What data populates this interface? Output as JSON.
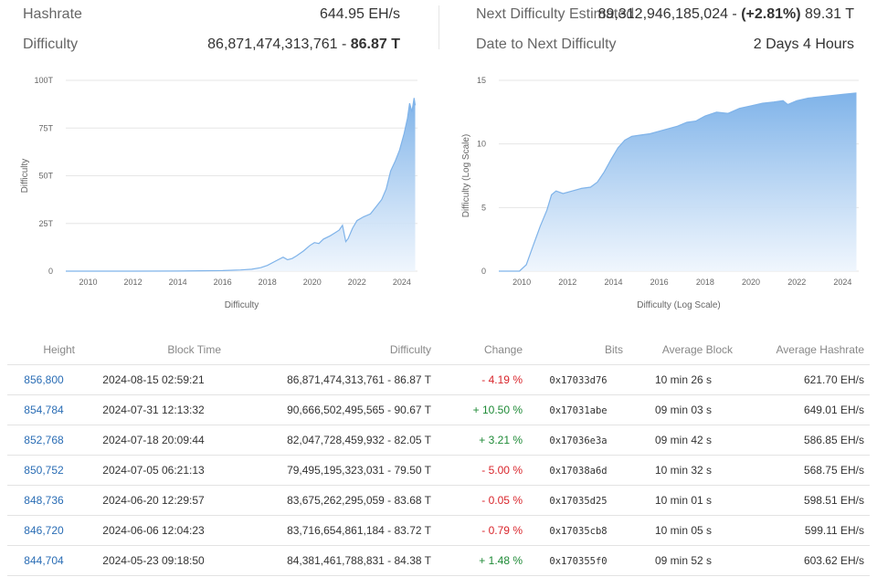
{
  "stats": {
    "hashrate_label": "Hashrate",
    "hashrate_value": "644.95 EH/s",
    "difficulty_label": "Difficulty",
    "difficulty_value_prefix": "86,871,474,313,761 - ",
    "difficulty_value_bold": "86.87 T",
    "next_label": "Next Difficulty Estimated",
    "next_value_prefix": "89,312,946,185,024 - ",
    "next_value_bold": "(+2.81%)",
    "next_value_suffix": " 89.31 T",
    "date_next_label": "Date to Next Difficulty",
    "date_next_value": "2 Days 4 Hours"
  },
  "colors": {
    "area_top": "#7fb3e9",
    "area_bottom": "#eef5fd",
    "line": "#7fb3e9",
    "grid": "#e6e6e6",
    "link": "#2a6db5",
    "negative": "#d9262c",
    "positive": "#1e8a36"
  },
  "chart_data": [
    {
      "type": "area",
      "xlabel": "Difficulty",
      "ylabel": "Difficulty",
      "xlim": [
        2009,
        2024.7
      ],
      "ylim": [
        0,
        100
      ],
      "yticks": [
        {
          "v": 0,
          "label": "0"
        },
        {
          "v": 25,
          "label": "25T"
        },
        {
          "v": 50,
          "label": "50T"
        },
        {
          "v": 75,
          "label": "75T"
        },
        {
          "v": 100,
          "label": "100T"
        }
      ],
      "xticks": [
        {
          "v": 2010,
          "label": "2010"
        },
        {
          "v": 2012,
          "label": "2012"
        },
        {
          "v": 2014,
          "label": "2014"
        },
        {
          "v": 2016,
          "label": "2016"
        },
        {
          "v": 2018,
          "label": "2018"
        },
        {
          "v": 2020,
          "label": "2020"
        },
        {
          "v": 2022,
          "label": "2022"
        },
        {
          "v": 2024,
          "label": "2024"
        }
      ],
      "grid": true,
      "x": [
        2009.0,
        2012.0,
        2014.0,
        2016.0,
        2016.8,
        2017.3,
        2017.7,
        2018.0,
        2018.4,
        2018.7,
        2018.9,
        2019.1,
        2019.3,
        2019.6,
        2019.9,
        2020.1,
        2020.3,
        2020.5,
        2020.8,
        2021.0,
        2021.2,
        2021.35,
        2021.5,
        2021.6,
        2021.8,
        2022.0,
        2022.3,
        2022.6,
        2022.9,
        2023.1,
        2023.3,
        2023.5,
        2023.7,
        2023.9,
        2024.1,
        2024.25,
        2024.35,
        2024.45,
        2024.55,
        2024.6
      ],
      "values": [
        0,
        0,
        0.04,
        0.3,
        0.6,
        1.0,
        1.8,
        3.0,
        5.5,
        7.3,
        6.0,
        6.6,
        8.0,
        10.5,
        13.5,
        15.0,
        14.5,
        16.8,
        18.5,
        20.0,
        21.5,
        24.0,
        15.5,
        17.0,
        22.5,
        26.5,
        28.5,
        30.0,
        34.5,
        37.5,
        43.0,
        52.5,
        57.5,
        63.5,
        72.0,
        80.0,
        88.0,
        83.5,
        90.7,
        86.9
      ]
    },
    {
      "type": "area",
      "xlabel": "Difficulty (Log Scale)",
      "ylabel": "Difficulty (Log Scale)",
      "xlim": [
        2009,
        2024.7
      ],
      "ylim": [
        0,
        15
      ],
      "yticks": [
        {
          "v": 0,
          "label": "0"
        },
        {
          "v": 5,
          "label": "5"
        },
        {
          "v": 10,
          "label": "10"
        },
        {
          "v": 15,
          "label": "15"
        }
      ],
      "xticks": [
        {
          "v": 2010,
          "label": "2010"
        },
        {
          "v": 2012,
          "label": "2012"
        },
        {
          "v": 2014,
          "label": "2014"
        },
        {
          "v": 2016,
          "label": "2016"
        },
        {
          "v": 2018,
          "label": "2018"
        },
        {
          "v": 2020,
          "label": "2020"
        },
        {
          "v": 2022,
          "label": "2022"
        },
        {
          "v": 2024,
          "label": "2024"
        }
      ],
      "grid": true,
      "x": [
        2009.0,
        2009.9,
        2010.2,
        2010.5,
        2010.8,
        2011.1,
        2011.3,
        2011.5,
        2011.8,
        2012.2,
        2012.6,
        2013.0,
        2013.3,
        2013.6,
        2013.9,
        2014.2,
        2014.5,
        2014.8,
        2015.2,
        2015.6,
        2016.0,
        2016.4,
        2016.8,
        2017.2,
        2017.6,
        2018.0,
        2018.5,
        2019.0,
        2019.5,
        2020.0,
        2020.5,
        2021.0,
        2021.4,
        2021.6,
        2022.0,
        2022.5,
        2023.0,
        2023.5,
        2024.0,
        2024.6
      ],
      "values": [
        0,
        0,
        0.5,
        2.0,
        3.5,
        4.8,
        6.0,
        6.3,
        6.1,
        6.3,
        6.5,
        6.6,
        7.0,
        7.8,
        8.8,
        9.7,
        10.3,
        10.6,
        10.7,
        10.8,
        11.0,
        11.2,
        11.4,
        11.7,
        11.8,
        12.2,
        12.5,
        12.4,
        12.8,
        13.0,
        13.2,
        13.3,
        13.4,
        13.1,
        13.4,
        13.6,
        13.7,
        13.8,
        13.9,
        14.0
      ]
    }
  ],
  "table": {
    "headers": [
      "Height",
      "Block Time",
      "Difficulty",
      "Change",
      "Bits",
      "Average Block",
      "Average Hashrate"
    ],
    "rows": [
      {
        "height": "856,800",
        "time": "2024-08-15 02:59:21",
        "difficulty": "86,871,474,313,761 - 86.87 T",
        "change": "- 4.19 %",
        "dir": "neg",
        "bits": "0x17033d76",
        "avg_block": "10 min 26 s",
        "avg_hashrate": "621.70 EH/s"
      },
      {
        "height": "854,784",
        "time": "2024-07-31 12:13:32",
        "difficulty": "90,666,502,495,565 - 90.67 T",
        "change": "+ 10.50 %",
        "dir": "pos",
        "bits": "0x17031abe",
        "avg_block": "09 min 03 s",
        "avg_hashrate": "649.01 EH/s"
      },
      {
        "height": "852,768",
        "time": "2024-07-18 20:09:44",
        "difficulty": "82,047,728,459,932 - 82.05 T",
        "change": "+ 3.21 %",
        "dir": "pos",
        "bits": "0x17036e3a",
        "avg_block": "09 min 42 s",
        "avg_hashrate": "586.85 EH/s"
      },
      {
        "height": "850,752",
        "time": "2024-07-05 06:21:13",
        "difficulty": "79,495,195,323,031 - 79.50 T",
        "change": "- 5.00 %",
        "dir": "neg",
        "bits": "0x17038a6d",
        "avg_block": "10 min 32 s",
        "avg_hashrate": "568.75 EH/s"
      },
      {
        "height": "848,736",
        "time": "2024-06-20 12:29:57",
        "difficulty": "83,675,262,295,059 - 83.68 T",
        "change": "- 0.05 %",
        "dir": "neg",
        "bits": "0x17035d25",
        "avg_block": "10 min 01 s",
        "avg_hashrate": "598.51 EH/s"
      },
      {
        "height": "846,720",
        "time": "2024-06-06 12:04:23",
        "difficulty": "83,716,654,861,184 - 83.72 T",
        "change": "- 0.79 %",
        "dir": "neg",
        "bits": "0x17035cb8",
        "avg_block": "10 min 05 s",
        "avg_hashrate": "599.11 EH/s"
      },
      {
        "height": "844,704",
        "time": "2024-05-23 09:18:50",
        "difficulty": "84,381,461,788,831 - 84.38 T",
        "change": "+ 1.48 %",
        "dir": "pos",
        "bits": "0x170355f0",
        "avg_block": "09 min 52 s",
        "avg_hashrate": "603.62 EH/s"
      }
    ]
  }
}
